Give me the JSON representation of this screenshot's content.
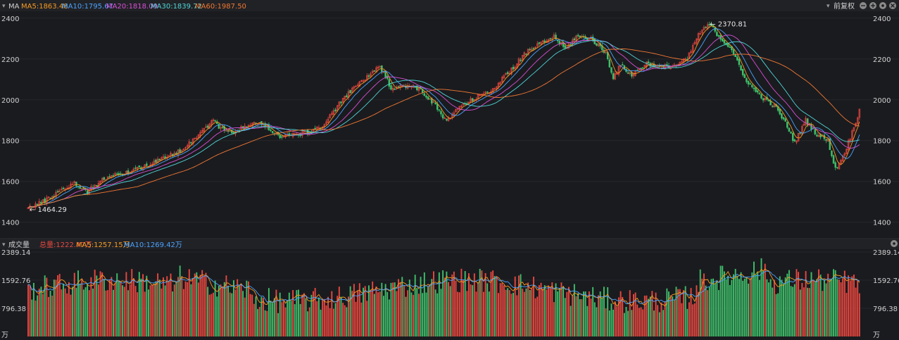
{
  "price_header": {
    "indicator": "MA",
    "ma5": "MA5:1863.48",
    "ma10": "MA10:1795.67",
    "ma20": "MA20:1818.09",
    "ma30": "MA30:1839.72",
    "ma60": "MA60:1987.50",
    "adjust": "前复权"
  },
  "volume_header": {
    "indicator": "成交量",
    "total": "总量:1222.47万",
    "ma5": "MA5:1257.15万",
    "ma10": "MA10:1269.42万"
  },
  "colors": {
    "up": "#e8473f",
    "down": "#3fbf6a",
    "ma5": "#f59a22",
    "ma10": "#4aa3ff",
    "ma20": "#d94fd6",
    "ma30": "#4fd6d6",
    "ma60": "#f07832",
    "vol_total": "#e8473f",
    "vol_ma5": "#f59a22",
    "vol_ma10": "#4aa3ff"
  },
  "chart_data": [
    {
      "type": "candlestick",
      "y_ticks": [
        "2400",
        "2200",
        "2000",
        "1800",
        "1600",
        "1400"
      ],
      "y_tick_values": [
        2400,
        2200,
        2000,
        1800,
        1600,
        1400
      ],
      "ylim": [
        1330,
        2420
      ],
      "high_label": "← 2370.81",
      "high_value": 2370.81,
      "low_label": "← 1464.29",
      "low_value": 1464.29,
      "series": [
        {
          "name": "MA5",
          "value": 1863.48
        },
        {
          "name": "MA10",
          "value": 1795.67
        },
        {
          "name": "MA20",
          "value": 1818.09
        },
        {
          "name": "MA30",
          "value": 1839.72
        },
        {
          "name": "MA60",
          "value": 1987.5
        }
      ],
      "path_anchors": [
        [
          0,
          1470
        ],
        [
          8,
          1500
        ],
        [
          18,
          1560
        ],
        [
          25,
          1590
        ],
        [
          32,
          1550
        ],
        [
          40,
          1610
        ],
        [
          55,
          1650
        ],
        [
          70,
          1700
        ],
        [
          82,
          1750
        ],
        [
          92,
          1830
        ],
        [
          100,
          1900
        ],
        [
          104,
          1860
        ],
        [
          110,
          1840
        ],
        [
          118,
          1870
        ],
        [
          124,
          1890
        ],
        [
          130,
          1860
        ],
        [
          136,
          1820
        ],
        [
          144,
          1830
        ],
        [
          152,
          1840
        ],
        [
          160,
          1880
        ],
        [
          168,
          1980
        ],
        [
          176,
          2060
        ],
        [
          184,
          2120
        ],
        [
          190,
          2160
        ],
        [
          196,
          2060
        ],
        [
          204,
          2070
        ],
        [
          212,
          2050
        ],
        [
          220,
          1970
        ],
        [
          226,
          1890
        ],
        [
          232,
          1960
        ],
        [
          242,
          2010
        ],
        [
          252,
          2060
        ],
        [
          262,
          2160
        ],
        [
          270,
          2240
        ],
        [
          278,
          2280
        ],
        [
          284,
          2310
        ],
        [
          290,
          2250
        ],
        [
          296,
          2310
        ],
        [
          304,
          2300
        ],
        [
          312,
          2230
        ],
        [
          316,
          2110
        ],
        [
          320,
          2170
        ],
        [
          326,
          2120
        ],
        [
          334,
          2180
        ],
        [
          342,
          2160
        ],
        [
          350,
          2170
        ],
        [
          356,
          2200
        ],
        [
          362,
          2320
        ],
        [
          368,
          2370
        ],
        [
          374,
          2300
        ],
        [
          380,
          2250
        ],
        [
          386,
          2120
        ],
        [
          392,
          2050
        ],
        [
          398,
          2000
        ],
        [
          404,
          1960
        ],
        [
          410,
          1870
        ],
        [
          414,
          1790
        ],
        [
          420,
          1900
        ],
        [
          426,
          1830
        ],
        [
          432,
          1800
        ],
        [
          436,
          1660
        ],
        [
          440,
          1720
        ],
        [
          445,
          1840
        ],
        [
          449,
          1950
        ]
      ]
    },
    {
      "type": "bar",
      "y_ticks": [
        "2389.14",
        "1592.76",
        "796.38",
        "万"
      ],
      "y_tick_values": [
        2389.14,
        1592.76,
        796.38
      ],
      "ylim": [
        0,
        2389.14
      ],
      "unit": "万",
      "series": [
        {
          "name": "总量",
          "value": 1222.47
        },
        {
          "name": "MA5",
          "value": 1257.15
        },
        {
          "name": "MA10",
          "value": 1269.42
        }
      ]
    }
  ]
}
